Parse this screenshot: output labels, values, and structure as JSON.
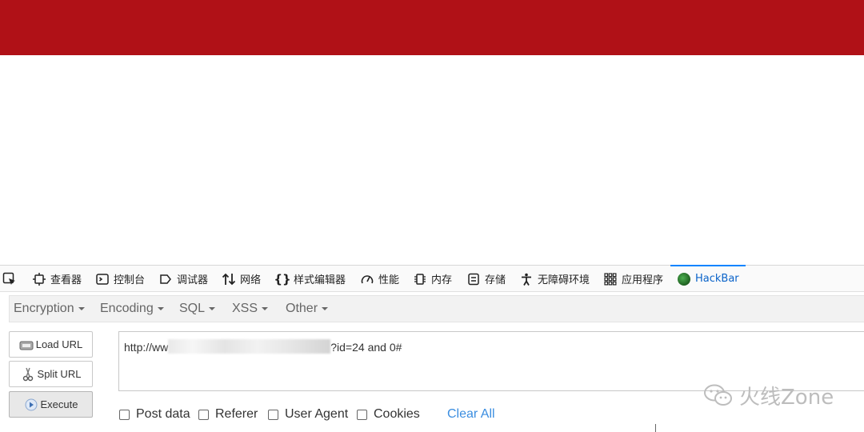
{
  "colors": {
    "banner": "#b01117",
    "accent": "#0a84ff",
    "link": "#3a8de0"
  },
  "devtools": {
    "tabs": [
      {
        "label": "查看器",
        "icon": "inspector-icon"
      },
      {
        "label": "控制台",
        "icon": "console-icon"
      },
      {
        "label": "调试器",
        "icon": "debugger-icon"
      },
      {
        "label": "网络",
        "icon": "network-icon"
      },
      {
        "label": "样式编辑器",
        "icon": "style-editor-icon"
      },
      {
        "label": "性能",
        "icon": "performance-icon"
      },
      {
        "label": "内存",
        "icon": "memory-icon"
      },
      {
        "label": "存储",
        "icon": "storage-icon"
      },
      {
        "label": "无障碍环境",
        "icon": "accessibility-icon"
      },
      {
        "label": "应用程序",
        "icon": "application-icon"
      },
      {
        "label": "HackBar",
        "icon": "hackbar-icon",
        "active": true
      }
    ]
  },
  "hackbar": {
    "menu": [
      "Encryption",
      "Encoding",
      "SQL",
      "XSS",
      "Other"
    ],
    "buttons": {
      "load": "Load URL",
      "split": "Split URL",
      "execute": "Execute"
    },
    "url": {
      "prefix": "http://ww",
      "suffix": "?id=24 and 0#"
    },
    "options": [
      "Post data",
      "Referer",
      "User Agent",
      "Cookies"
    ],
    "clear_all": "Clear All"
  },
  "watermark": {
    "text": "火线Zone"
  }
}
